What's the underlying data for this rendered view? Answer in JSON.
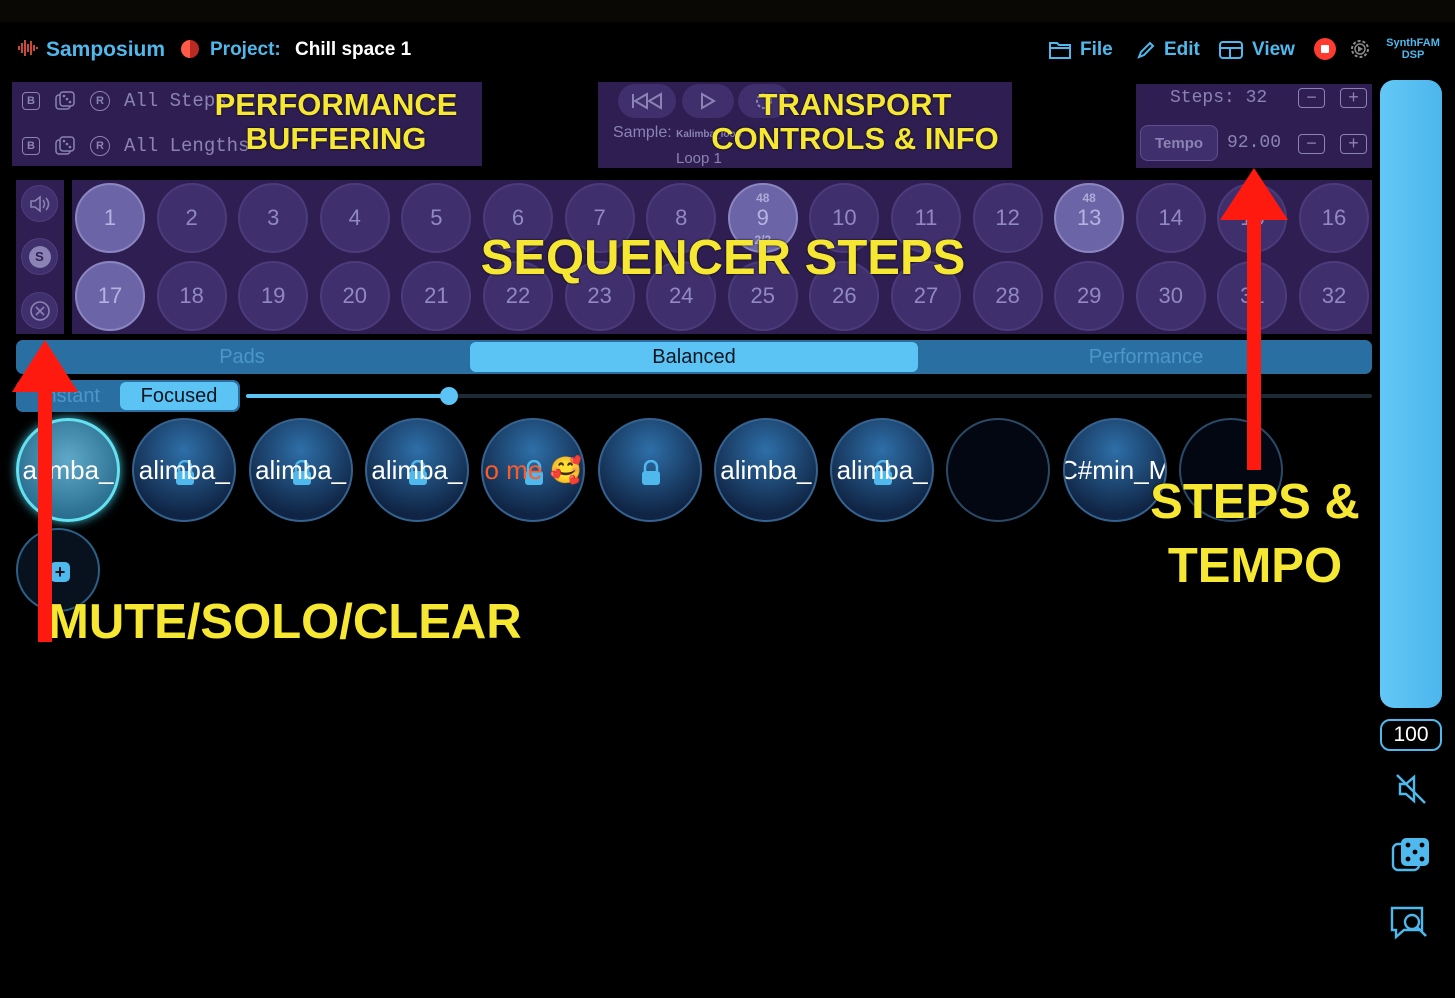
{
  "header": {
    "app_name": "Samposium",
    "project_label": "Project:",
    "project_name": "Chill space 1",
    "menu": {
      "file": "File",
      "edit": "Edit",
      "view": "View"
    },
    "dsp_badge_line1": "SynthFAM",
    "dsp_badge_line2": "DSP",
    "accent_color": "#4fb8ec",
    "record_color": "#ff3b30"
  },
  "buffering": {
    "row1": {
      "b": "B",
      "r": "R",
      "text": "All Steps"
    },
    "row2": {
      "b": "B",
      "r": "R",
      "text": "All Lengths"
    }
  },
  "transport": {
    "sample_label": "Sample:",
    "sample_name": "Kalimba_loop",
    "loop_label": "Loop 1"
  },
  "steps_tempo": {
    "steps_label": "Steps: 32",
    "tempo_button": "Tempo",
    "tempo_value": "92.00",
    "minus": "−",
    "plus": "+"
  },
  "mute_solo_clear": {
    "solo_label": "S"
  },
  "sequencer": {
    "row1": [
      "1",
      "2",
      "3",
      "4",
      "5",
      "6",
      "7",
      "8",
      "9",
      "10",
      "11",
      "12",
      "13",
      "14",
      "15",
      "16"
    ],
    "row2": [
      "17",
      "18",
      "19",
      "20",
      "21",
      "22",
      "23",
      "24",
      "25",
      "26",
      "27",
      "28",
      "29",
      "30",
      "31",
      "32"
    ],
    "step9_top": "48",
    "step9_bottom": "2/2",
    "step13_top": "48"
  },
  "modes": {
    "pads": "Pads",
    "balanced": "Balanced",
    "performance": "Performance",
    "selected": "Balanced"
  },
  "focus": {
    "instant": "Instant",
    "focused": "Focused",
    "selected": "Focused",
    "slider_fraction": 0.18
  },
  "pads": [
    {
      "label": "alimba_"
    },
    {
      "label": "alimba_"
    },
    {
      "label": "alimba_"
    },
    {
      "label": "alimba_"
    },
    {
      "label": "o me 🥰"
    },
    {
      "label": ""
    },
    {
      "label": "alimba_"
    },
    {
      "label": "alimba_"
    },
    {
      "label": ""
    },
    {
      "label": "C#min_M"
    },
    {
      "label": ""
    }
  ],
  "add_pad": "+",
  "volume": {
    "value": "100",
    "fill_fraction": 1.0
  },
  "annotations": {
    "performance_buffering": "PERFORMANCE BUFFERING",
    "transport": "TRANSPORT CONTROLS & INFO",
    "sequencer": "SEQUENCER STEPS",
    "steps_tempo_1": "STEPS &",
    "steps_tempo_2": "TEMPO",
    "mute_solo_clear": "MUTE/SOLO/CLEAR",
    "color": "#f6e832",
    "arrow_color": "#ff1a10"
  }
}
